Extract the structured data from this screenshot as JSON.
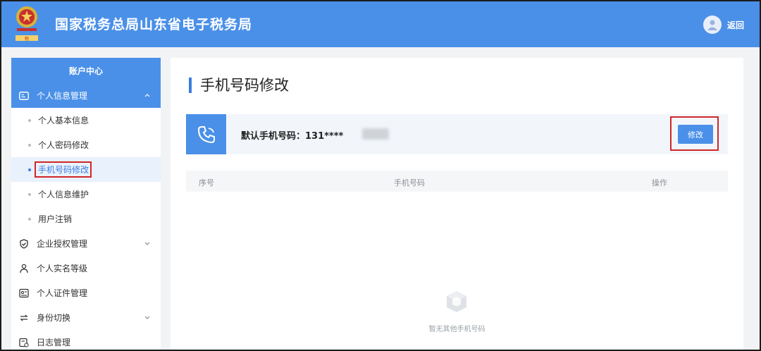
{
  "header": {
    "title": "国家税务总局山东省电子税务局",
    "back_label": "返回",
    "emblem_icon": "tax-emblem-icon",
    "user_icon": "user-avatar-icon"
  },
  "sidebar": {
    "title": "账户中心",
    "groups": [
      {
        "label": "个人信息管理",
        "icon": "id-card-icon",
        "expanded": true
      },
      {
        "label": "企业授权管理",
        "icon": "shield-check-icon"
      },
      {
        "label": "个人实名等级",
        "icon": "person-icon"
      },
      {
        "label": "个人证件管理",
        "icon": "id-document-icon"
      },
      {
        "label": "身份切换",
        "icon": "switch-icon"
      },
      {
        "label": "日志管理",
        "icon": "log-icon"
      }
    ],
    "sub_items": [
      {
        "label": "个人基本信息"
      },
      {
        "label": "个人密码修改"
      },
      {
        "label": "手机号码修改",
        "selected": true
      },
      {
        "label": "个人信息维护"
      },
      {
        "label": "用户注销"
      }
    ]
  },
  "main": {
    "page_title": "手机号码修改",
    "phone_label": "默认手机号码：131****",
    "edit_label": "修改",
    "table": {
      "columns": [
        "序号",
        "手机号码",
        "操作"
      ]
    },
    "empty_text": "暂无其他手机号码"
  },
  "colors": {
    "primary": "#4a90e8",
    "highlight": "#d0262a"
  }
}
